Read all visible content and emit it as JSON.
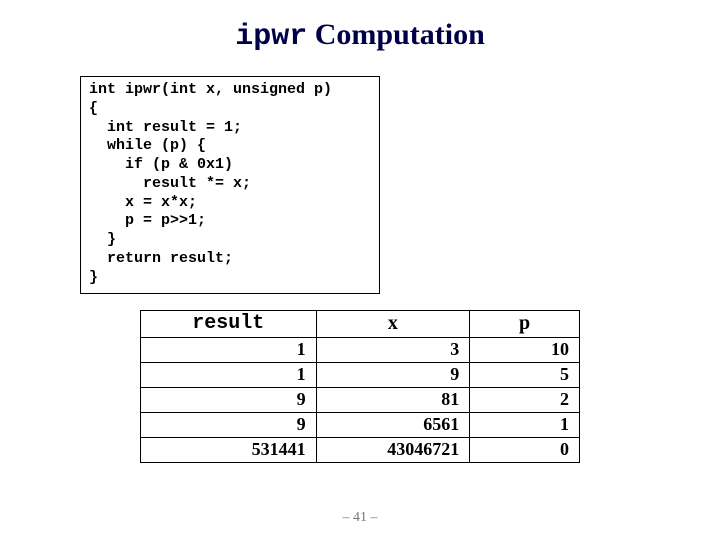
{
  "title": {
    "mono": "ipwr",
    "rest": " Computation"
  },
  "code": "int ipwr(int x, unsigned p)\n{\n  int result = 1;\n  while (p) {\n    if (p & 0x1)\n      result *= x;\n    x = x*x;\n    p = p>>1;\n  }\n  return result;\n}",
  "chart_data": {
    "type": "table",
    "columns": [
      "result",
      "x",
      "p"
    ],
    "rows": [
      {
        "result": "1",
        "x": "3",
        "p": "10"
      },
      {
        "result": "1",
        "x": "9",
        "p": "5"
      },
      {
        "result": "9",
        "x": "81",
        "p": "2"
      },
      {
        "result": "9",
        "x": "6561",
        "p": "1"
      },
      {
        "result": "531441",
        "x": "43046721",
        "p": "0"
      }
    ]
  },
  "footer": "– 41 –"
}
